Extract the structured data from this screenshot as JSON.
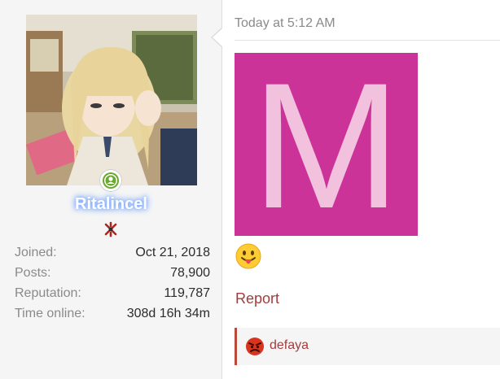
{
  "post": {
    "user": {
      "username": "Ritalincel",
      "avatar_icon": "anime-girl-avatar",
      "online_icon": "online-user-icon",
      "rank_icon": "angry-emblem-icon",
      "stats": [
        {
          "label": "Joined:",
          "value": "Oct 21, 2018"
        },
        {
          "label": "Posts:",
          "value": "78,900"
        },
        {
          "label": "Reputation:",
          "value": "119,787"
        },
        {
          "label": "Time online:",
          "value": "308d 16h 34m"
        }
      ]
    },
    "message": {
      "timestamp": "Today at 5:12 AM",
      "image_letter": "M",
      "image_color": "#cc3399",
      "emoji": "tongue-out-emoji",
      "report_label": "Report",
      "reaction": {
        "icon": "angry-face-icon",
        "username": "defaya"
      }
    }
  },
  "colors": {
    "link": "#a33d3d",
    "accent_border": "#b84a3a",
    "label_grey": "#8a8a8a",
    "sidebar_bg": "#f5f5f5"
  }
}
